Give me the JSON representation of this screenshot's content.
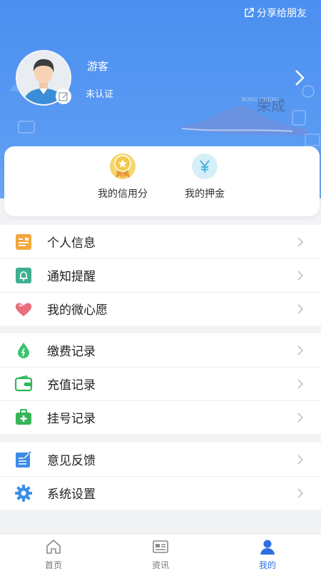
{
  "header": {
    "share_label": "分享给朋友",
    "username": "游客",
    "status": "未认证",
    "brand_text": "荣成",
    "brand_sub": "RONG CHENG"
  },
  "card": {
    "items": [
      {
        "label": "我的信用分",
        "icon": "medal-icon"
      },
      {
        "label": "我的押金",
        "icon": "yuan-icon"
      }
    ]
  },
  "menu": {
    "group1": [
      {
        "label": "个人信息",
        "icon": "id-card-icon"
      },
      {
        "label": "通知提醒",
        "icon": "bell-icon"
      },
      {
        "label": "我的微心愿",
        "icon": "heart-icon"
      }
    ],
    "group2": [
      {
        "label": "缴费记录",
        "icon": "drop-icon"
      },
      {
        "label": "充值记录",
        "icon": "wallet-icon"
      },
      {
        "label": "挂号记录",
        "icon": "medical-kit-icon"
      }
    ],
    "group3": [
      {
        "label": "意见反馈",
        "icon": "feedback-icon"
      },
      {
        "label": "系统设置",
        "icon": "gear-icon"
      }
    ]
  },
  "tabbar": {
    "tabs": [
      {
        "label": "首页",
        "icon": "home-icon"
      },
      {
        "label": "资讯",
        "icon": "news-icon"
      },
      {
        "label": "我的",
        "icon": "user-icon",
        "active": true
      }
    ]
  },
  "colors": {
    "header_blue": "#4b8ff0",
    "active_tab": "#2f6fe0"
  }
}
